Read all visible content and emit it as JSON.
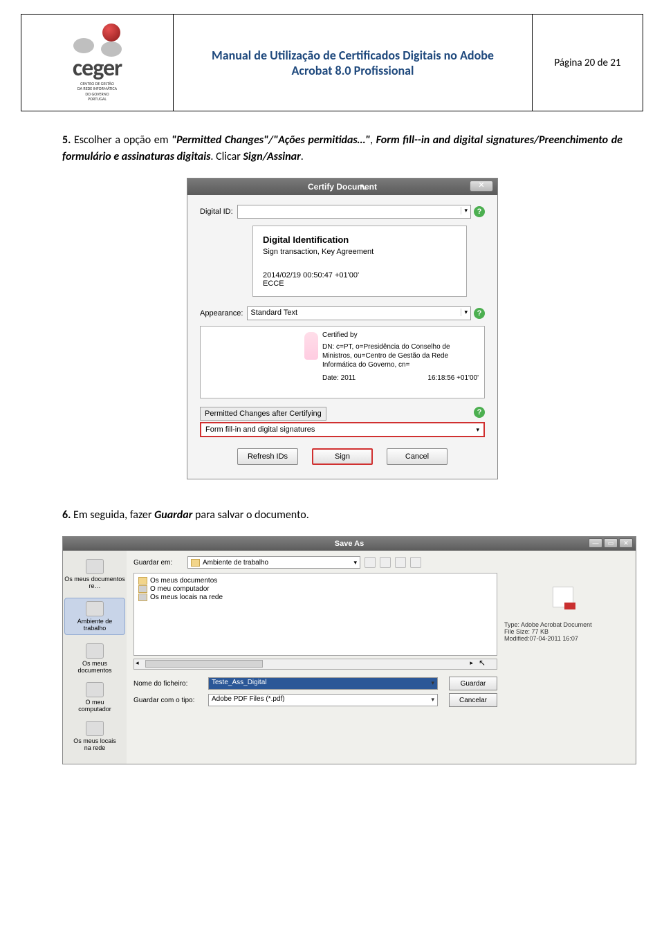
{
  "header": {
    "logo_name": "ceger",
    "logo_sub1": "CENTRO DE GESTÃO",
    "logo_sub2": "DA REDE INFORMÁTICA",
    "logo_sub3": "DO GOVERNO",
    "logo_sub4": "PORTUGAL",
    "title_line1": "Manual de Utilização de Certificados Digitais no Adobe",
    "title_line2": "Acrobat 8.0 Profissional",
    "page_info": "Página 20 de 21"
  },
  "step5": {
    "num": "5.",
    "t1": "Escolher a opção em ",
    "q1": "\"Permitted Changes\"/\"Ações permitidas…\"",
    "t2": ", ",
    "q2": "Form fill--in and digital signatures/Preenchimento de formulário e assinaturas digitais",
    "t3": ". Clicar ",
    "q3": "Sign/Assinar",
    "t4": "."
  },
  "certify": {
    "title": "Certify Document",
    "close": "✕",
    "digital_id_label": "Digital ID:",
    "info_title": "Digital Identification",
    "info_sub": "Sign transaction, Key Agreement",
    "info_date": "2014/02/19 00:50:47 +01'00'",
    "info_ecce": "ECCE",
    "appearance_label": "Appearance:",
    "appearance_value": "Standard Text",
    "preview_certified": "Certified by",
    "preview_dn": "DN: c=PT, o=Presidência do Conselho de Ministros, ou=Centro de Gestão da Rede Informática do Governo, cn=",
    "preview_date_lbl": "Date: 2011",
    "preview_time": "16:18:56 +01'00'",
    "permitted_label": "Permitted Changes after Certifying",
    "permitted_value": "Form fill-in and digital signatures",
    "btn_refresh": "Refresh IDs",
    "btn_sign": "Sign",
    "btn_cancel": "Cancel"
  },
  "step6": {
    "num": "6.",
    "t1": "Em seguida, fazer ",
    "q1": "Guardar",
    "t2": " para salvar o documento."
  },
  "saveas": {
    "title": "Save As",
    "min": "—",
    "max": "▭",
    "close": "✕",
    "side": {
      "recent": "Os meus documentos re…",
      "desktop1": "Ambiente de",
      "desktop2": "trabalho",
      "docs1": "Os meus",
      "docs2": "documentos",
      "pc1": "O meu",
      "pc2": "computador",
      "net1": "Os meus locais",
      "net2": "na rede"
    },
    "loc_label": "Guardar em:",
    "loc_value": "Ambiente de trabalho",
    "list": {
      "i1": "Os meus documentos",
      "i2": "O meu computador",
      "i3": "Os meus locais na rede"
    },
    "info_type": "Type: Adobe Acrobat Document",
    "info_size": "File Size: 77 KB",
    "info_mod": "Modified:07-04-2011 16:07",
    "fname_label": "Nome do ficheiro:",
    "fname_value": "Teste_Ass_Digital",
    "ftype_label": "Guardar com o tipo:",
    "ftype_value": "Adobe PDF Files (*.pdf)",
    "btn_save": "Guardar",
    "btn_cancel": "Cancelar"
  }
}
